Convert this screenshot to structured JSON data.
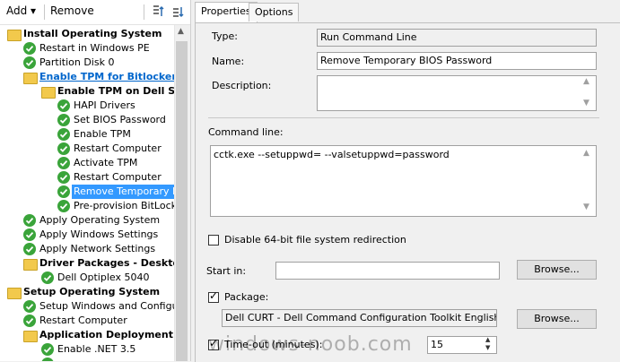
{
  "toolbar": {
    "add_label": "Add ▾",
    "remove_label": "Remove"
  },
  "tree": [
    {
      "label": "Install Operating System",
      "icon": "folder",
      "group": true,
      "indent": 0
    },
    {
      "label": "Restart in Windows PE",
      "icon": "check",
      "indent": 1
    },
    {
      "label": "Partition Disk 0",
      "icon": "check",
      "indent": 1
    },
    {
      "label": "Enable TPM for Bitlocker",
      "icon": "folder",
      "link": true,
      "indent": 1
    },
    {
      "label": "Enable TPM on Dell S",
      "icon": "folder",
      "group": true,
      "indent": 2
    },
    {
      "label": "HAPI Drivers",
      "icon": "check",
      "indent": 3
    },
    {
      "label": "Set BIOS Password",
      "icon": "check",
      "indent": 3
    },
    {
      "label": "Enable TPM",
      "icon": "check",
      "indent": 3
    },
    {
      "label": "Restart Computer",
      "icon": "check",
      "indent": 3
    },
    {
      "label": "Activate TPM",
      "icon": "check",
      "indent": 3
    },
    {
      "label": "Restart Computer",
      "icon": "check",
      "indent": 3
    },
    {
      "label": "Remove Temporary Bi",
      "icon": "check",
      "selected": true,
      "indent": 3
    },
    {
      "label": "Pre-provision BitLocke",
      "icon": "check",
      "indent": 3
    },
    {
      "label": "Apply Operating System",
      "icon": "check",
      "indent": 1
    },
    {
      "label": "Apply Windows Settings",
      "icon": "check",
      "indent": 1
    },
    {
      "label": "Apply Network Settings",
      "icon": "check",
      "indent": 1
    },
    {
      "label": "Driver Packages - Deskto",
      "icon": "folder",
      "group": true,
      "indent": 1
    },
    {
      "label": "Dell Optiplex 5040",
      "icon": "check",
      "indent": 2
    },
    {
      "label": "Setup Operating System",
      "icon": "folder",
      "group": true,
      "indent": 0
    },
    {
      "label": "Setup Windows and Configura",
      "icon": "check",
      "indent": 1
    },
    {
      "label": "Restart Computer",
      "icon": "check",
      "indent": 1
    },
    {
      "label": "Application Deployment",
      "icon": "folder",
      "group": true,
      "indent": 1
    },
    {
      "label": "Enable .NET 3.5",
      "icon": "check",
      "indent": 2
    },
    {
      "label": "",
      "icon": "check",
      "indent": 2
    }
  ],
  "tabs": {
    "properties": "Properties",
    "options": "Options"
  },
  "form": {
    "type_label": "Type:",
    "type_value": "Run Command Line",
    "name_label": "Name:",
    "name_value": "Remove Temporary BIOS Password",
    "description_label": "Description:",
    "description_value": "",
    "command_label": "Command line:",
    "command_value": "cctk.exe --setuppwd= --valsetuppwd=password",
    "disable64_label": "Disable 64-bit file system redirection",
    "disable64_checked": false,
    "startin_label": "Start in:",
    "startin_value": "",
    "browse_label": "Browse...",
    "package_label": "Package:",
    "package_checked": true,
    "package_value": "Dell CURT - Dell Command Configuration Toolkit  English",
    "timeout_label": "Time-out (minutes):",
    "timeout_checked": true,
    "timeout_value": "15"
  },
  "watermark": "windows-noob.com"
}
